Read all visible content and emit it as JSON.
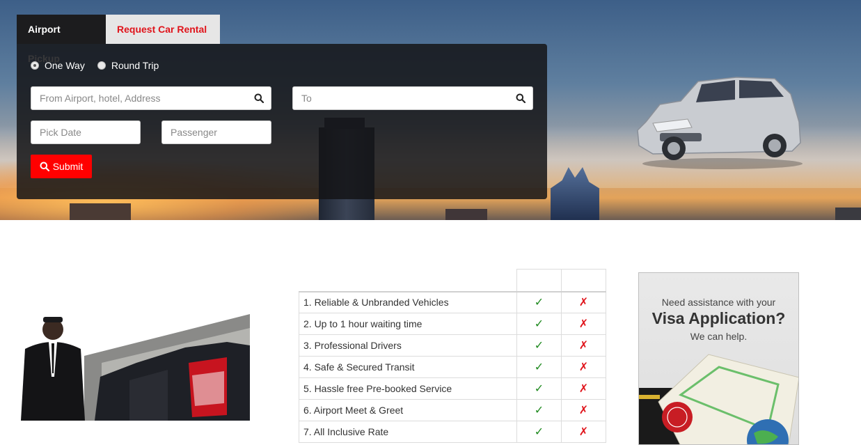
{
  "tabs": {
    "airport_pickup": "Airport Pickup",
    "request_car_rental": "Request Car Rental"
  },
  "trip_type": {
    "options": [
      "One Way",
      "Round Trip"
    ],
    "selected": "One Way"
  },
  "form": {
    "from_placeholder": "From Airport, hotel, Address",
    "to_placeholder": "To",
    "date_placeholder": "Pick Date",
    "passenger_placeholder": "Passenger",
    "submit_label": "Submit"
  },
  "comparison": {
    "rows": [
      {
        "feature": "1. Reliable & Unbranded Vehicles",
        "yes": "✓",
        "no": "✗"
      },
      {
        "feature": "2. Up to 1 hour waiting time",
        "yes": "✓",
        "no": "✗"
      },
      {
        "feature": "3. Professional Drivers",
        "yes": "✓",
        "no": "✗"
      },
      {
        "feature": "4. Safe & Secured Transit",
        "yes": "✓",
        "no": "✗"
      },
      {
        "feature": "5. Hassle free Pre-booked Service",
        "yes": "✓",
        "no": "✗"
      },
      {
        "feature": "6. Airport Meet & Greet",
        "yes": "✓",
        "no": "✗"
      },
      {
        "feature": "7. All Inclusive Rate",
        "yes": "✓",
        "no": "✗"
      }
    ]
  },
  "visa_ad": {
    "line1": "Need assistance with your",
    "line2": "Visa Application?",
    "line3": "We can help."
  },
  "colors": {
    "accent_red": "#ff0000",
    "tab_text_red": "#e0141b",
    "check_green": "#1f8a1f",
    "panel_dark": "#1c1c1e"
  },
  "icons": {
    "search": "search-icon",
    "check": "check-icon",
    "cross": "cross-icon"
  }
}
